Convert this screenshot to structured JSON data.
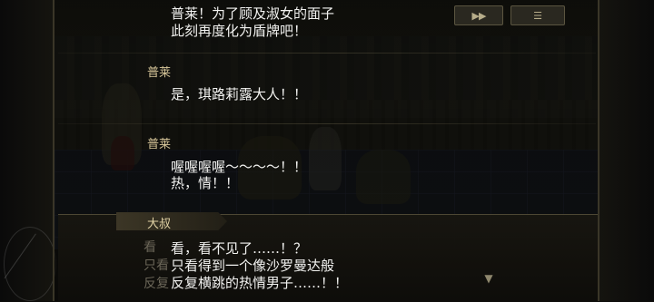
{
  "controls": {
    "auto_label": "▶▶",
    "menu_label": "☰"
  },
  "log": [
    {
      "speaker": "",
      "lines": [
        "普莱！为了顾及淑女的面子",
        "此刻再度化为盾牌吧！"
      ]
    },
    {
      "speaker": "普莱",
      "lines": [
        "是，琪路莉露大人！！"
      ]
    },
    {
      "speaker": "普莱",
      "lines": [
        "喔喔喔喔～～～～！！",
        "热，情！！"
      ]
    }
  ],
  "current": {
    "speaker": "大叔",
    "lines": [
      "看，看不见了……！？",
      "只看得到一个像沙罗曼达般",
      "反复横跳的热情男子……！！"
    ],
    "ghost_text": [
      "看",
      "只看",
      "反复"
    ]
  },
  "colors": {
    "speaker": "#d8c79a",
    "dialogue": "#f2f2f0",
    "frame": "#3a3628"
  }
}
